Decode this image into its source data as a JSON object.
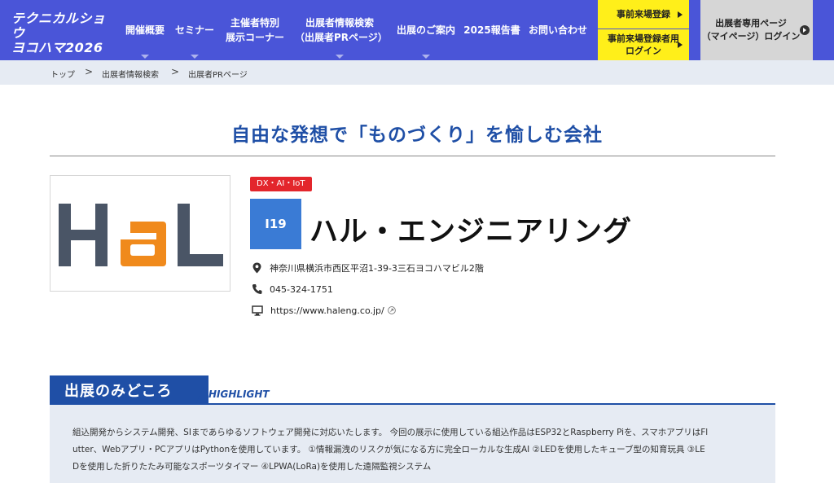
{
  "header": {
    "logo_line1": "テクニカルショウ",
    "logo_line2": "ヨコハマ2026",
    "nav": [
      {
        "label": "開催概要",
        "has_dropdown": true
      },
      {
        "label": "セミナー",
        "has_dropdown": true
      },
      {
        "label": "主催者特別\n展示コーナー",
        "has_dropdown": false
      },
      {
        "label": "出展者情報検索\n（出展者PRページ）",
        "has_dropdown": true
      },
      {
        "label": "出展のご案内",
        "has_dropdown": true
      },
      {
        "label": "2025報告書",
        "has_dropdown": false
      },
      {
        "label": "お問い合わせ",
        "has_dropdown": false
      }
    ],
    "cta_register": "事前来場登録",
    "cta_register_login": "事前来場登録者用\nログイン",
    "cta_mypage": "出展者専用ページ\n（マイページ）ログイン",
    "colors": {
      "nav_bg": "#4a55d8",
      "cta_yellow": "#ffef1a",
      "cta_gray": "#d6d6d6"
    }
  },
  "breadcrumb": [
    {
      "label": "トップ"
    },
    {
      "label": "出展者情報検索"
    },
    {
      "label": "出展者PRページ"
    }
  ],
  "page": {
    "title": "自由な発想で「ものづくり」を愉しむ会社"
  },
  "company": {
    "logo_text": "HaL",
    "logo_colors": {
      "primary": "#4a5566",
      "accent": "#f08a1c"
    },
    "category_tag": "DX・AI・IoT",
    "booth": "I19",
    "name": "ハル・エンジニアリング",
    "address": "神奈川県横浜市西区平沼1-39-3三石ヨコハマビル2階",
    "phone": "045-324-1751",
    "url": "https://www.haleng.co.jp/",
    "icons": {
      "address": "map-pin-icon",
      "phone": "phone-icon",
      "url": "monitor-icon",
      "external": "external-link-icon"
    }
  },
  "highlight": {
    "heading": "出展のみどころ",
    "subheading": "HIGHLIGHT",
    "lines": [
      "組込開発からシステム開発、SIまであらゆるソフトウェア開発に対応いたします。 今回の展示に使用している組込作品はESP32とRaspberry Piを、スマホアプリはFl",
      "utter、Webアプリ・PCアプリはPythonを使用しています。 ①情報漏洩のリスクが気になる方に完全ローカルな生成AI ②LEDを使用したキューブ型の知育玩具 ③LE",
      "Dを使用した折りたたみ可能なスポーツタイマー ④LPWA(LoRa)を使用した遠隔監視システム"
    ],
    "colors": {
      "accent": "#1f4fa6",
      "body_bg": "#e6ebf3"
    }
  }
}
